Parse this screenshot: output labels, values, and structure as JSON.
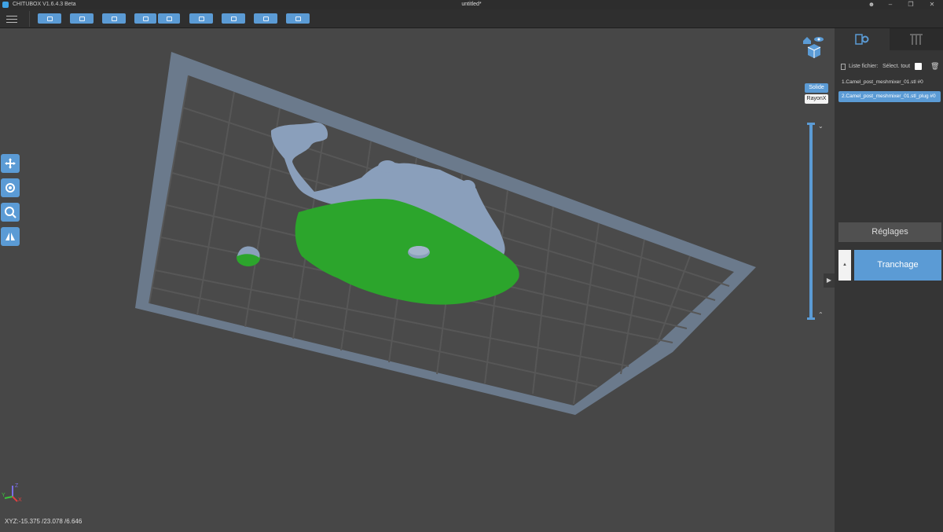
{
  "titlebar": {
    "app_name": "CHITUBOX V1.6.4.3 Beta",
    "document": "untitled*"
  },
  "toolbar": {
    "buttons": [
      "open-icon",
      "save-icon",
      "autolayout-icon",
      "import-icon",
      "export-icon",
      "camera-icon",
      "hollow-icon",
      "drop-icon",
      "frame-icon"
    ]
  },
  "viewport": {
    "display_modes": {
      "solid": "Solide",
      "xray": "RayonX"
    },
    "axes": {
      "x": "X",
      "y": "Y",
      "z": "Z"
    },
    "coords": "XYZ:-15.375 /23.078 /6.646"
  },
  "panel": {
    "file_list_label": "Liste fichier:",
    "select_all_label": "Sélect. tout",
    "files": [
      "1.Camel_post_meshmixer_01.stl #0",
      "2.Camel_post_meshmixer_01.stl_plug #0"
    ],
    "settings_label": "Réglages",
    "slice_label": "Tranchage"
  },
  "colors": {
    "accent": "#5b9bd5",
    "model": "#8a9fbb",
    "contact": "#2ca52c",
    "plate": "#6b7a8c"
  }
}
